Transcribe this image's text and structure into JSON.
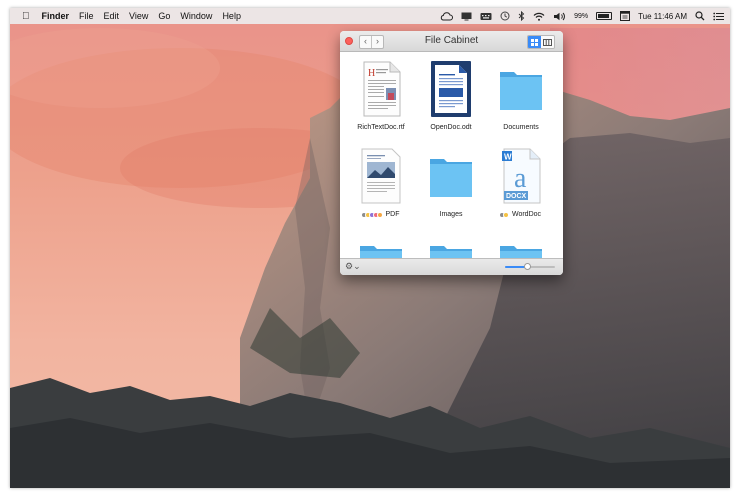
{
  "menubar": {
    "apple_icon": "apple-icon",
    "app_name": "Finder",
    "menus": [
      "File",
      "Edit",
      "View",
      "Go",
      "Window",
      "Help"
    ],
    "battery_percent": "99%",
    "clock": "Tue 11:46 AM"
  },
  "window": {
    "title": "File Cabinet",
    "back_glyph": "‹",
    "forward_glyph": "›",
    "items": [
      {
        "label": "RichTextDoc.rtf",
        "icon": "rtf-document-icon",
        "tags": []
      },
      {
        "label": "OpenDoc.odt",
        "icon": "odt-document-icon",
        "tags": []
      },
      {
        "label": "Documents",
        "icon": "folder-icon",
        "tags": []
      },
      {
        "label": "PDF",
        "icon": "pdf-document-icon",
        "tags": [
          "#8c8c8c",
          "#f5c242",
          "#8e72d6",
          "#ef6b7d",
          "#f5a742"
        ]
      },
      {
        "label": "Images",
        "icon": "folder-icon",
        "tags": []
      },
      {
        "label": "WordDoc",
        "icon": "word-document-icon",
        "tags": [
          "#8c8c8c",
          "#f5c242"
        ]
      },
      {
        "label": "",
        "icon": "folder-icon",
        "tags": []
      },
      {
        "label": "",
        "icon": "folder-icon",
        "tags": []
      },
      {
        "label": "",
        "icon": "folder-icon",
        "tags": []
      }
    ],
    "icon_size_slider": 0.45,
    "gear_glyph": "⚙",
    "gear_caret": "⌄"
  },
  "colors": {
    "accent": "#3a8bf7",
    "folder": "#5fb7ef",
    "close": "#fc605c"
  }
}
